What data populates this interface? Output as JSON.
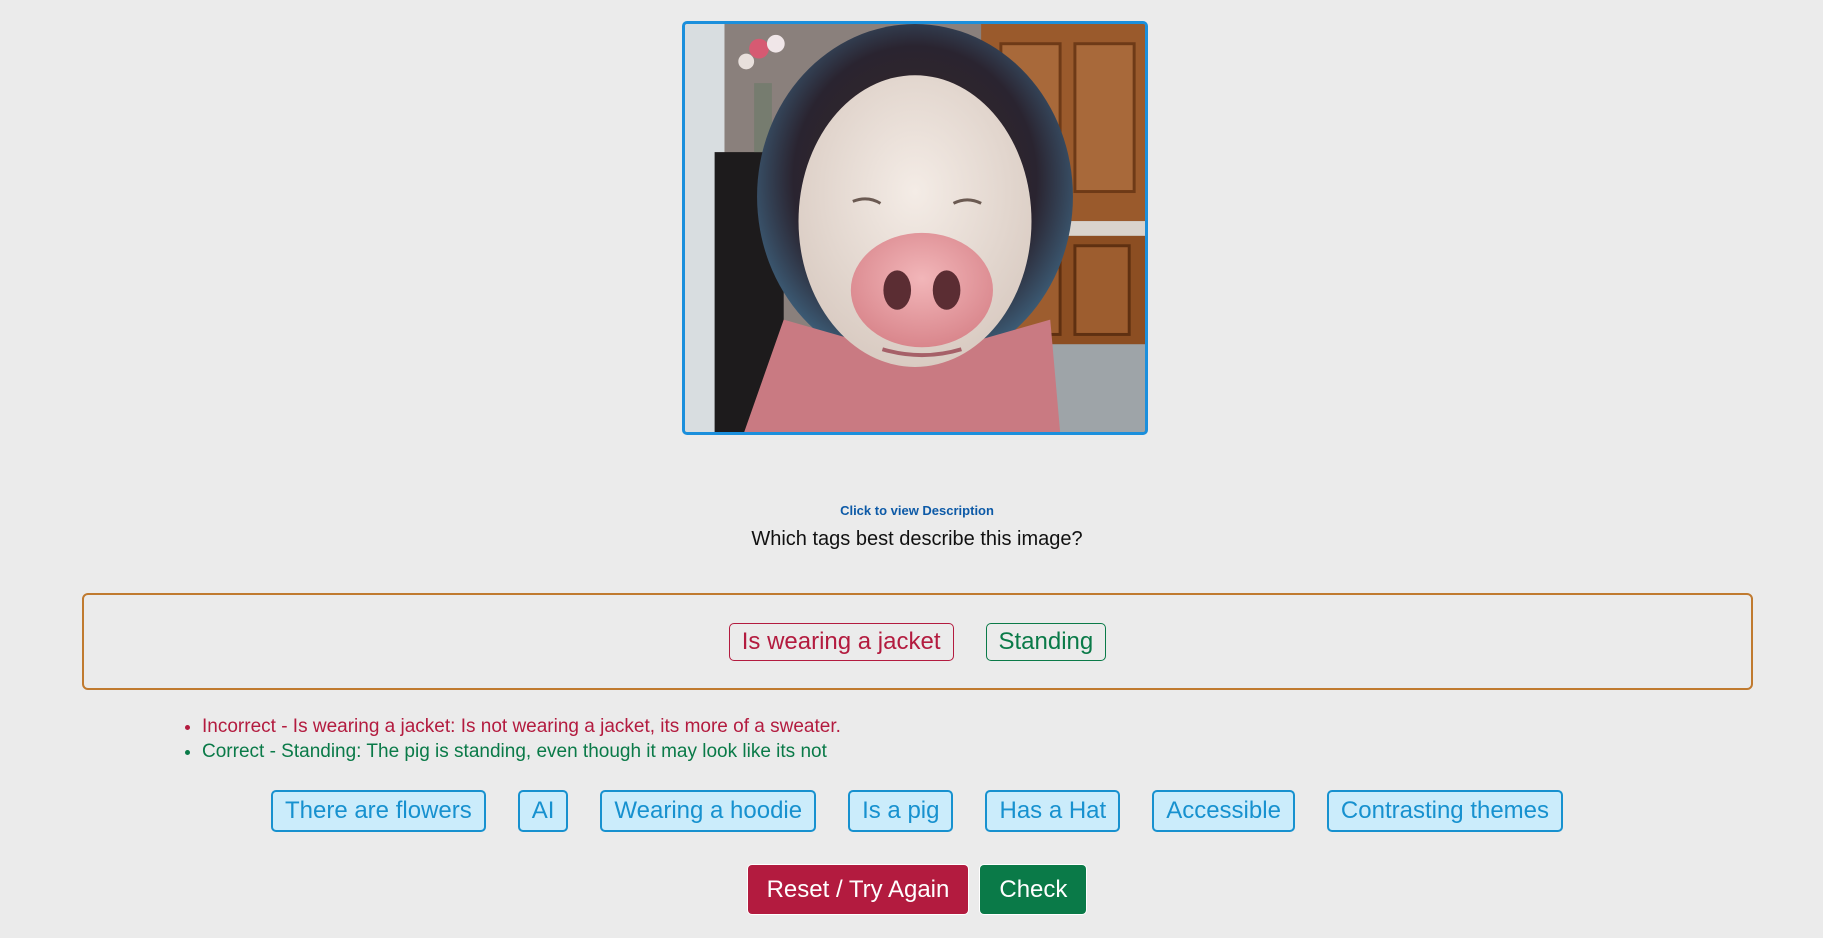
{
  "description_link": "Click to view Description",
  "question": "Which tags best describe this image?",
  "selected_tags": [
    {
      "label": "Is wearing a jacket",
      "status": "incorrect"
    },
    {
      "label": "Standing",
      "status": "correct"
    }
  ],
  "feedback": [
    {
      "text": "Incorrect - Is wearing a jacket: Is not wearing a jacket, its more of a sweater.",
      "status": "incorrect"
    },
    {
      "text": "Correct - Standing: The pig is standing, even though it may look like its not",
      "status": "correct"
    }
  ],
  "available_tags": [
    "There are flowers",
    "AI",
    "Wearing a hoodie",
    "Is a pig",
    "Has a Hat",
    "Accessible",
    "Contrasting themes"
  ],
  "buttons": {
    "reset": "Reset / Try Again",
    "check": "Check"
  },
  "colors": {
    "correct": "#0a7a48",
    "incorrect": "#b31b3f",
    "tag_accent": "#1791cf",
    "drop_zone_border": "#c07a2f",
    "image_border": "#1b8fdc"
  }
}
